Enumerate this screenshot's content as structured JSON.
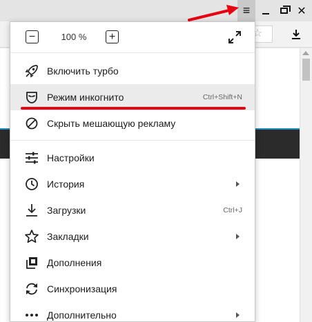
{
  "zoom": {
    "minus_label": "−",
    "value": "100 %",
    "plus_label": "+"
  },
  "menu": {
    "items": [
      {
        "name": "turbo",
        "label": "Включить турбо",
        "icon": "rocket-icon"
      },
      {
        "name": "incognito",
        "label": "Режим инкогнито",
        "shortcut": "Ctrl+Shift+N",
        "icon": "incognito-mask-icon",
        "highlighted": true
      },
      {
        "name": "block-ads",
        "label": "Скрыть мешающую рекламу",
        "icon": "block-icon"
      },
      {
        "name": "settings",
        "label": "Настройки",
        "icon": "sliders-icon"
      },
      {
        "name": "history",
        "label": "История",
        "icon": "clock-icon",
        "submenu": true
      },
      {
        "name": "downloads",
        "label": "Загрузки",
        "shortcut": "Ctrl+J",
        "icon": "download-icon"
      },
      {
        "name": "bookmarks",
        "label": "Закладки",
        "icon": "star-icon",
        "submenu": true
      },
      {
        "name": "extensions",
        "label": "Дополнения",
        "icon": "extensions-icon"
      },
      {
        "name": "sync",
        "label": "Синхронизация",
        "icon": "sync-icon"
      },
      {
        "name": "more",
        "label": "Дополнительно",
        "icon": "more-dots-icon",
        "submenu": true
      }
    ]
  },
  "window_controls": {
    "menu_glyph": "≡",
    "close_glyph": "✕"
  },
  "colors": {
    "annotation_red": "#e60012",
    "highlight_bg": "#ebebeb",
    "page_accent": "#1f8fb8"
  }
}
